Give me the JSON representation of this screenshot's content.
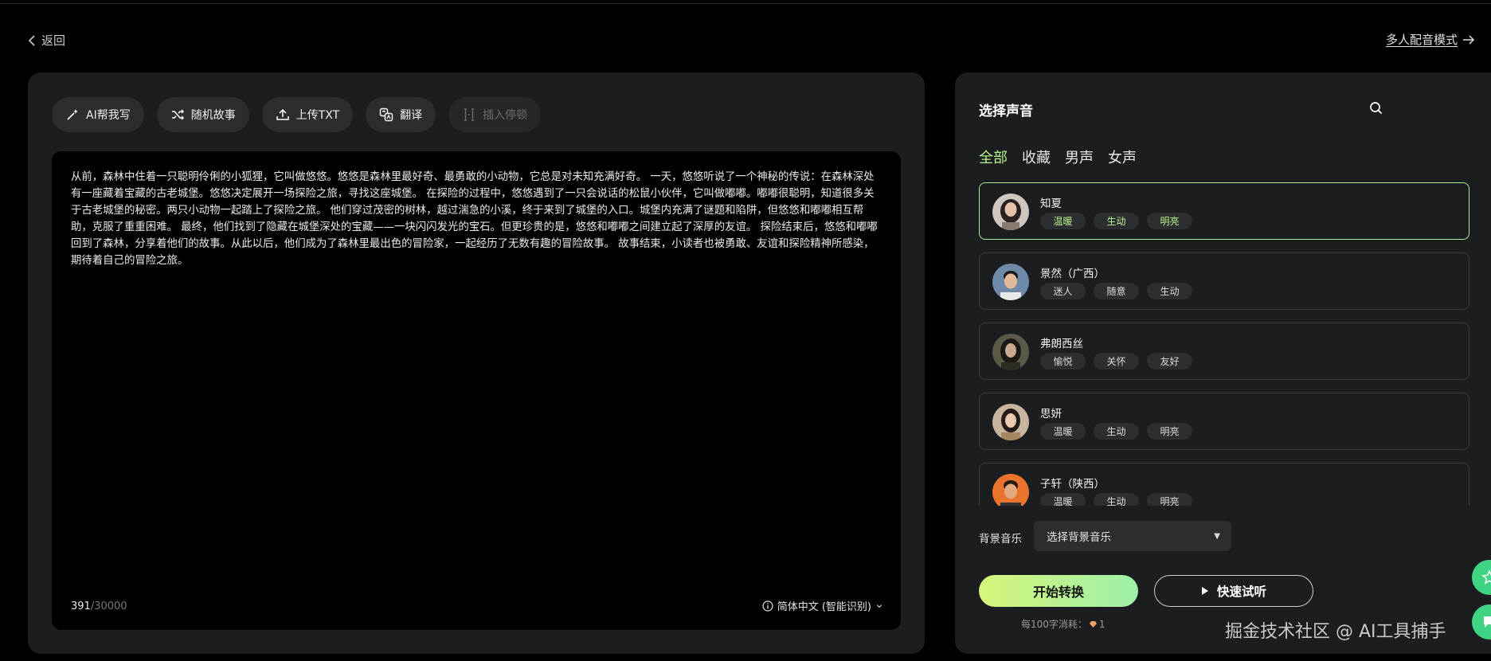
{
  "header": {
    "back_label": "返回",
    "multi_mode_label": "多人配音模式"
  },
  "toolbar": {
    "ai_write": "AI帮我写",
    "random_story": "随机故事",
    "upload_txt": "上传TXT",
    "translate": "翻译",
    "insert_pause": "插入停顿"
  },
  "editor": {
    "text": "从前，森林中住着一只聪明伶俐的小狐狸，它叫做悠悠。悠悠是森林里最好奇、最勇敢的小动物，它总是对未知充满好奇。 一天，悠悠听说了一个神秘的传说：在森林深处有一座藏着宝藏的古老城堡。悠悠决定展开一场探险之旅，寻找这座城堡。 在探险的过程中，悠悠遇到了一只会说话的松鼠小伙伴，它叫做嘟嘟。嘟嘟很聪明，知道很多关于古老城堡的秘密。两只小动物一起踏上了探险之旅。 他们穿过茂密的树林，越过湍急的小溪，终于来到了城堡的入口。城堡内充满了谜题和陷阱，但悠悠和嘟嘟相互帮助，克服了重重困难。 最终，他们找到了隐藏在城堡深处的宝藏——一块闪闪发光的宝石。但更珍贵的是，悠悠和嘟嘟之间建立起了深厚的友谊。 探险结束后，悠悠和嘟嘟回到了森林，分享着他们的故事。从此以后，他们成为了森林里最出色的冒险家，一起经历了无数有趣的冒险故事。 故事结束，小读者也被勇敢、友谊和探险精神所感染，期待着自己的冒险之旅。",
    "char_count": "391",
    "char_max": "/30000",
    "language": "简体中文 (智能识别)"
  },
  "voice_panel": {
    "title": "选择声音",
    "tabs": [
      "全部",
      "收藏",
      "男声",
      "女声"
    ],
    "voices": [
      {
        "name": "知夏",
        "tags": [
          "温暖",
          "生动",
          "明亮"
        ]
      },
      {
        "name": "景然（广西）",
        "tags": [
          "迷人",
          "随意",
          "生动"
        ]
      },
      {
        "name": "弗朗西丝",
        "tags": [
          "愉悦",
          "关怀",
          "友好"
        ]
      },
      {
        "name": "思妍",
        "tags": [
          "温暖",
          "生动",
          "明亮"
        ]
      },
      {
        "name": "子轩（陕西）",
        "tags": [
          "温暖",
          "生动",
          "明亮"
        ]
      }
    ],
    "bgm_label": "背景音乐",
    "bgm_select": "选择背景音乐",
    "start_label": "开始转换",
    "listen_label": "快速试听",
    "cost_text": "每100字消耗：",
    "cost_value": "1"
  },
  "watermark": "掘金技术社区 @ AI工具捕手",
  "colors": {
    "accent_green": "#b7f48a",
    "panel_bg": "#1c1d20",
    "fab_green": "#3fd483"
  },
  "icons": [
    "chevron-left-icon",
    "arrow-right-icon",
    "sparkle-icon",
    "shuffle-icon",
    "upload-icon",
    "translate-icon",
    "pause-insert-icon",
    "info-icon",
    "chevron-down-icon",
    "search-icon",
    "play-icon",
    "gem-icon",
    "star-icon",
    "chat-icon"
  ]
}
